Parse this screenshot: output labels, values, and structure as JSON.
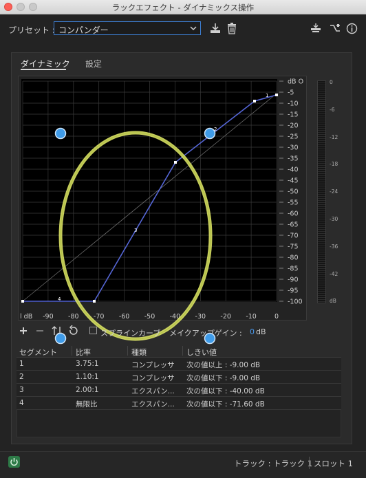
{
  "window": {
    "title": "ラックエフェクト - ダイナミックス操作"
  },
  "preset": {
    "label": "プリセット :",
    "value": "コンパンダー"
  },
  "tabs": [
    {
      "label": "ダイナミック",
      "active": true
    },
    {
      "label": "設定",
      "active": false
    }
  ],
  "graph": {
    "x_ticks": [
      "l dB",
      "-90",
      "-80",
      "-70",
      "-60",
      "-50",
      "-40",
      "-30",
      "-20",
      "-10",
      "0"
    ],
    "y_ticks": [
      "dB O",
      "-5",
      "-10",
      "-15",
      "-20",
      "-25",
      "-30",
      "-35",
      "-40",
      "-45",
      "-50",
      "-55",
      "-60",
      "-65",
      "-70",
      "-75",
      "-80",
      "-85",
      "-90",
      "-95",
      "-100"
    ],
    "segment_labels": [
      "1",
      "2",
      "3",
      "4"
    ]
  },
  "meter": {
    "ticks": [
      "0",
      "-6",
      "-12",
      "-18",
      "-24",
      "-30",
      "-36",
      "-42",
      "dB"
    ]
  },
  "controls": {
    "spline_label": "スプラインカーブ",
    "makeup_gain_label": "メイクアップゲイン :",
    "makeup_gain_value": "0",
    "makeup_gain_unit": "dB"
  },
  "table": {
    "headers": [
      "セグメント",
      "比率",
      "種類",
      "しきい値"
    ],
    "rows": [
      [
        "1",
        "3.75:1",
        "コンプレッサ",
        "次の値以上 : -9.00 dB"
      ],
      [
        "2",
        "1.10:1",
        "コンプレッサ",
        "次の値以下 : -9.00 dB"
      ],
      [
        "3",
        "2.00:1",
        "エクスパン...",
        "次の値以下 : -40.00 dB"
      ],
      [
        "4",
        "無限比",
        "エクスパン...",
        "次の値以下 : -71.60 dB"
      ]
    ]
  },
  "footer": {
    "track": "トラック : トラック 1",
    "slot": "スロット 1"
  },
  "colors": {
    "accent": "#3d7fd4",
    "curve": "#5566d6",
    "highlight": "#e6ee6a",
    "marker": "#3f9be8",
    "power": "#2d7a47"
  }
}
